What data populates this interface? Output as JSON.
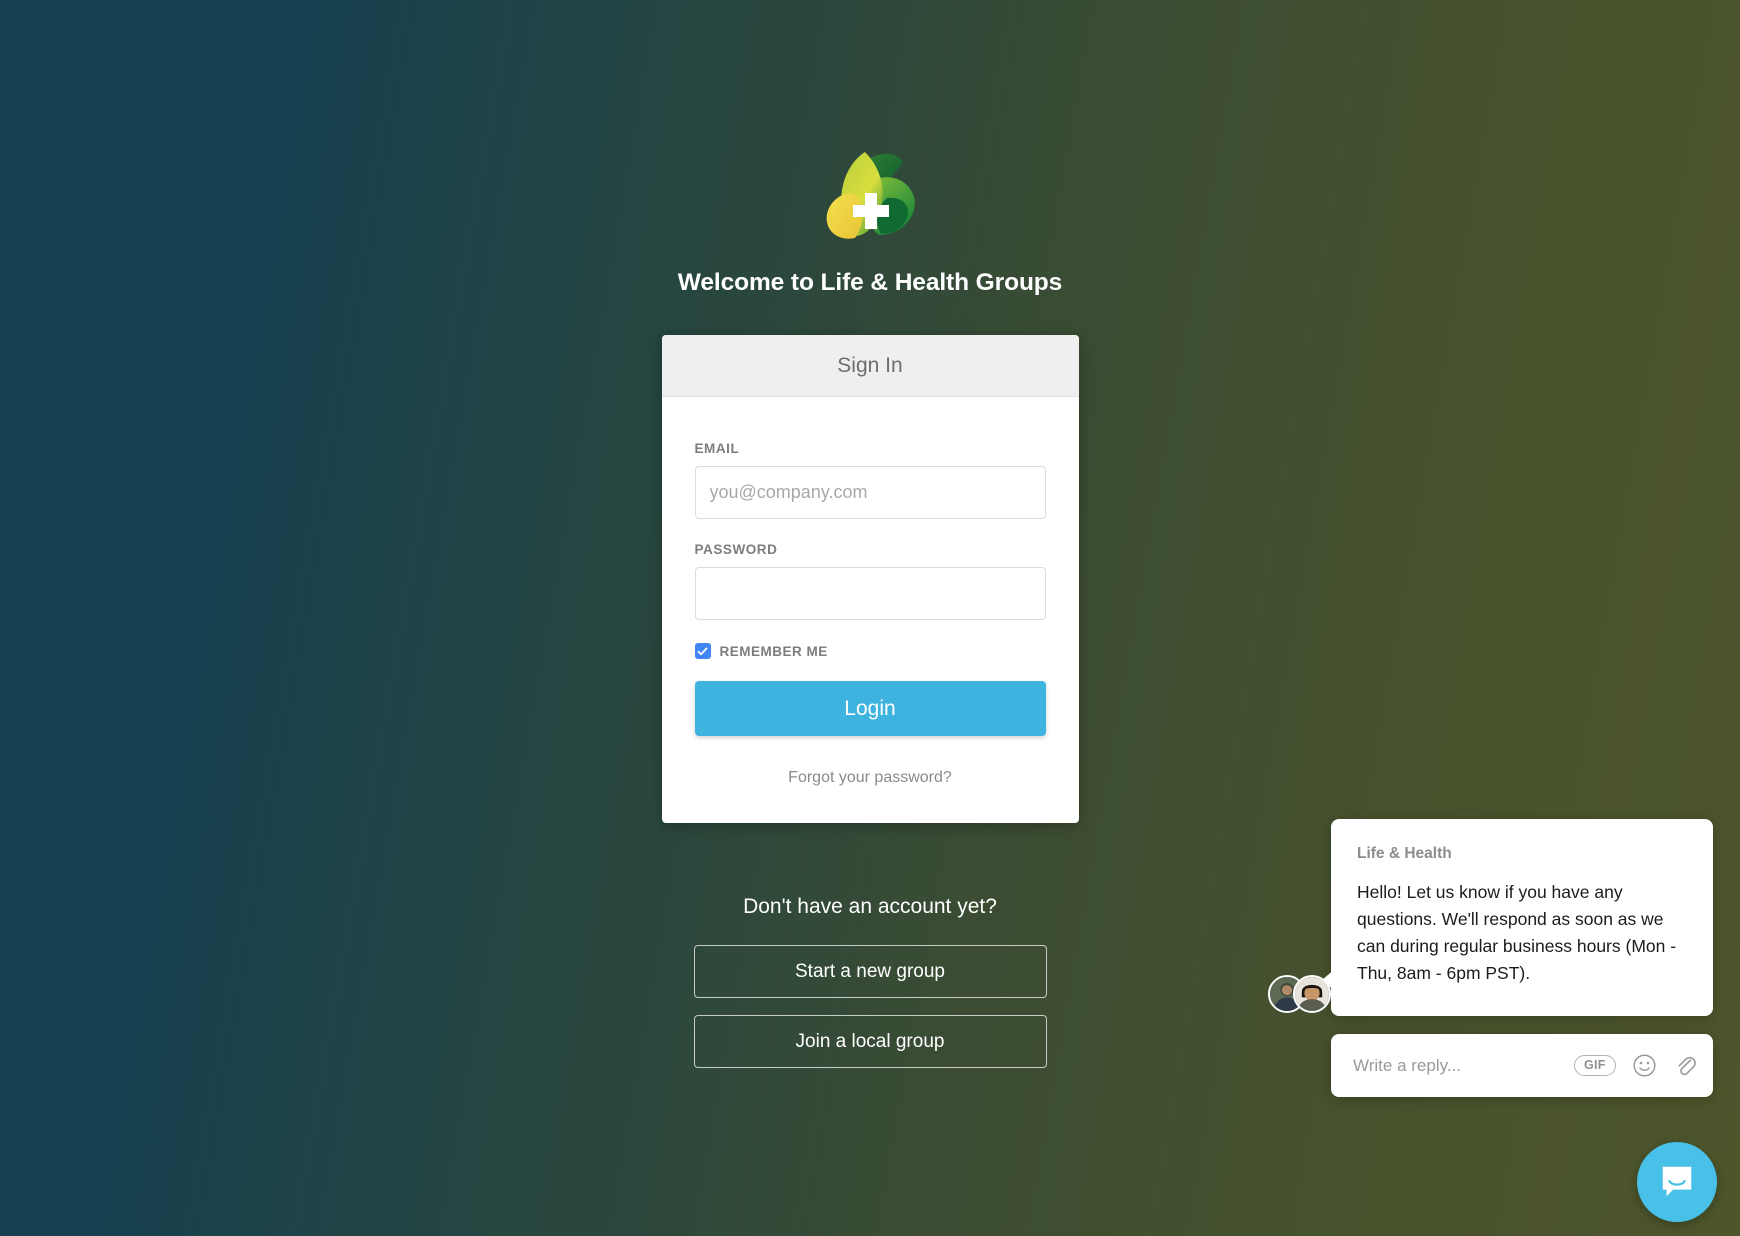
{
  "page": {
    "welcome_title": "Welcome to Life & Health Groups",
    "logo_icon": "leaf-cross-logo",
    "bg_gradient_from": "#16404f",
    "bg_gradient_to": "#4d552b"
  },
  "signin_card": {
    "header_title": "Sign In",
    "email": {
      "label": "EMAIL",
      "placeholder": "you@company.com",
      "value": ""
    },
    "password": {
      "label": "PASSWORD",
      "placeholder": "",
      "value": ""
    },
    "remember_me": {
      "label": "REMEMBER ME",
      "checked": true,
      "accent_color": "#4285f4"
    },
    "login_button": {
      "label": "Login",
      "color": "#3fb3e0"
    },
    "forgot_link": "Forgot your password?"
  },
  "signup": {
    "question": "Don't have an account yet?",
    "start_group_button": "Start a new group",
    "join_group_button": "Join a local group"
  },
  "intercom": {
    "message": {
      "sender": "Life & Health",
      "body": "Hello! Let us know if you have any questions. We'll respond as soon as we can during regular business hours (Mon - Thu, 8am - 6pm PST)."
    },
    "reply": {
      "placeholder": "Write a reply...",
      "value": "",
      "gif_label": "GIF",
      "emoji_icon": "smiley-icon",
      "attach_icon": "paperclip-icon"
    },
    "launcher": {
      "icon": "chat-bubble-icon",
      "color": "#49c0e8"
    },
    "avatars": [
      "agent-avatar-1",
      "agent-avatar-2"
    ]
  }
}
